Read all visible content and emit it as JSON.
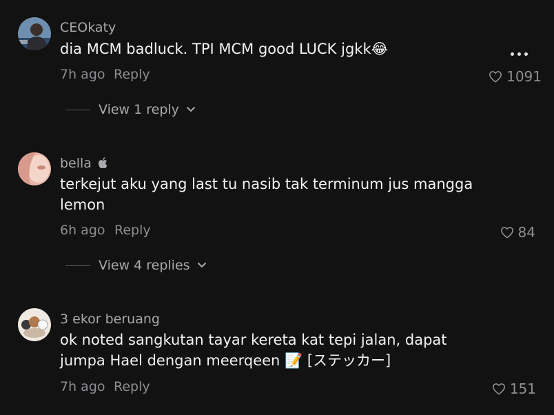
{
  "comments": [
    {
      "username": "CEOkaty",
      "text": "dia MCM badluck. TPI MCM good LUCK jgkk😂",
      "time": "7h ago",
      "reply_label": "Reply",
      "likes": "1091",
      "view_replies": "View 1 reply",
      "avatar_icon": "avatar-photo"
    },
    {
      "username": "bella",
      "text": "terkejut aku yang last tu nasib tak terminum jus mangga lemon",
      "time": "6h ago",
      "reply_label": "Reply",
      "likes": "84",
      "view_replies": "View 4 replies",
      "avatar_icon": "avatar-photo"
    },
    {
      "username": "3 ekor beruang",
      "text": "ok noted sangkutan tayar kereta kat tepi jalan, dapat jumpa Hael dengan meerqeen 📝 [ステッカー]",
      "time": "7h ago",
      "reply_label": "Reply",
      "likes": "151",
      "avatar_icon": "avatar-bears"
    }
  ],
  "colors": {
    "background": "#121212",
    "username": "#a9a9ad",
    "meta": "#8e8e93",
    "text": "#f2f2f2"
  }
}
